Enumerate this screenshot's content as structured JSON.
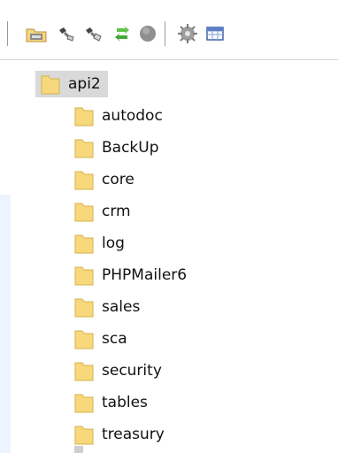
{
  "toolbar": {
    "buttons": [
      {
        "name": "open-icon"
      },
      {
        "name": "disconnect-icon"
      },
      {
        "name": "connect-icon"
      },
      {
        "name": "refresh-icon"
      },
      {
        "name": "stop-icon"
      },
      {
        "name": "settings-icon"
      },
      {
        "name": "table-icon"
      }
    ]
  },
  "tree": {
    "root": {
      "label": "api2"
    },
    "children": [
      {
        "label": "autodoc"
      },
      {
        "label": "BackUp"
      },
      {
        "label": "core"
      },
      {
        "label": "crm"
      },
      {
        "label": "log"
      },
      {
        "label": "PHPMailer6"
      },
      {
        "label": "sales"
      },
      {
        "label": "sca"
      },
      {
        "label": "security"
      },
      {
        "label": "tables"
      },
      {
        "label": "treasury"
      }
    ]
  },
  "colors": {
    "folder_fill": "#f7d87c",
    "folder_stroke": "#d7b24b",
    "selection_bg": "#d9d9d9",
    "toolbar_separator": "#9a9a9a"
  }
}
